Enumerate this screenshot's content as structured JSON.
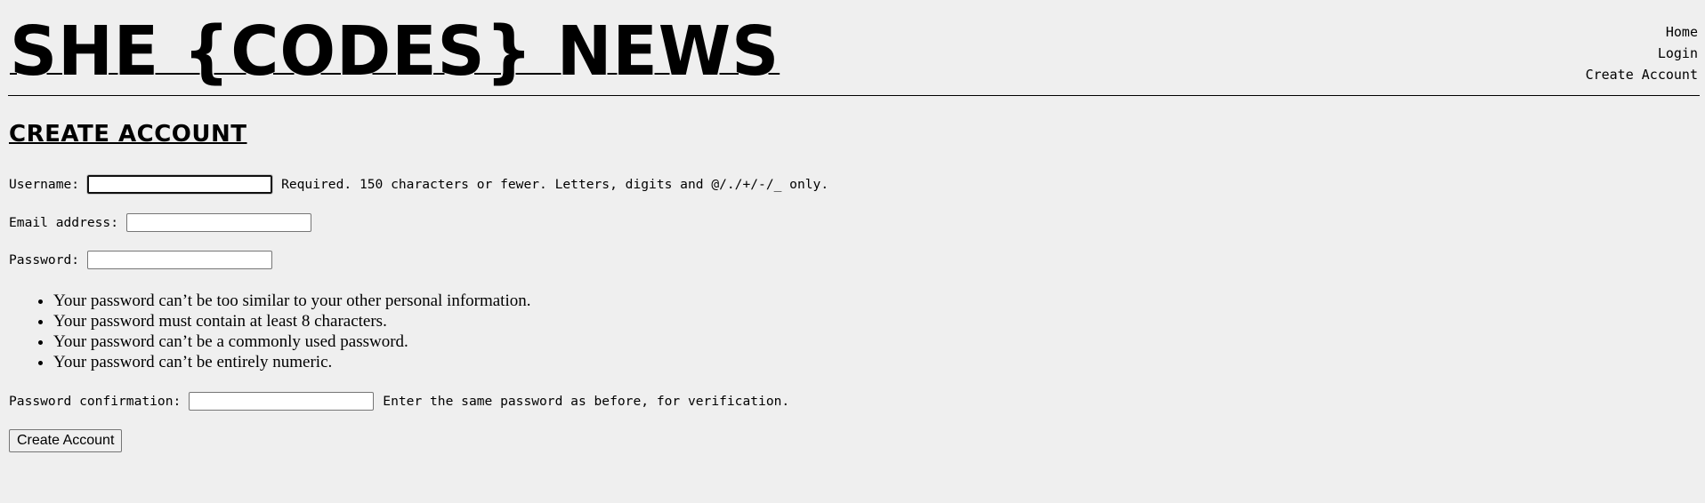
{
  "header": {
    "site_title": "SHE {CODES} NEWS",
    "nav": {
      "home": "Home",
      "login": "Login",
      "create_account": "Create Account"
    }
  },
  "page": {
    "heading": "CREATE ACCOUNT"
  },
  "form": {
    "username": {
      "label": "Username:",
      "value": "",
      "help": "Required. 150 characters or fewer. Letters, digits and @/./+/-/_ only."
    },
    "email": {
      "label": "Email address:",
      "value": ""
    },
    "password": {
      "label": "Password:",
      "value": "",
      "rules": [
        "Your password can’t be too similar to your other personal information.",
        "Your password must contain at least 8 characters.",
        "Your password can’t be a commonly used password.",
        "Your password can’t be entirely numeric."
      ]
    },
    "password_confirmation": {
      "label": "Password confirmation:",
      "value": "",
      "help": "Enter the same password as before, for verification."
    },
    "submit_label": "Create Account"
  }
}
